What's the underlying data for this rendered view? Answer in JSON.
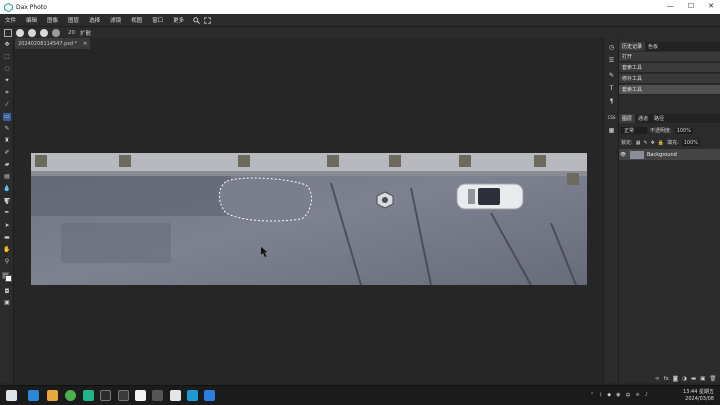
{
  "app": {
    "title": "Dax Photo"
  },
  "window": {
    "minimize": "—",
    "maximize": "☐",
    "close": "✕"
  },
  "menu": [
    "文件",
    "编辑",
    "图像",
    "图层",
    "选择",
    "滤镜",
    "视图",
    "窗口",
    "更多"
  ],
  "options": {
    "size_value": "20",
    "mode_label": "扩散"
  },
  "document": {
    "tab_label": "20240208114547.psd *",
    "close": "✕"
  },
  "history_panel": {
    "tabs": [
      "历史记录",
      "色板"
    ],
    "items": [
      "打开",
      "套索工具",
      "修补工具",
      "套索工具"
    ]
  },
  "side_strip": {
    "css_label": "CSS"
  },
  "layers_panel": {
    "tabs": [
      "图层",
      "通道",
      "路径"
    ],
    "blend_mode": "正常",
    "opacity_label": "不透明度:",
    "opacity_value": "100%",
    "lock_label": "锁定:",
    "fill_label": "填充:",
    "fill_value": "100%",
    "layer_name": "Background"
  },
  "taskbar": {
    "time": "13:44 星期五",
    "date": "2024/03/08"
  },
  "colors": {
    "accent": "#3a5f9c",
    "panel_bg": "#2b2b2b",
    "canvas_bg": "#262626"
  }
}
